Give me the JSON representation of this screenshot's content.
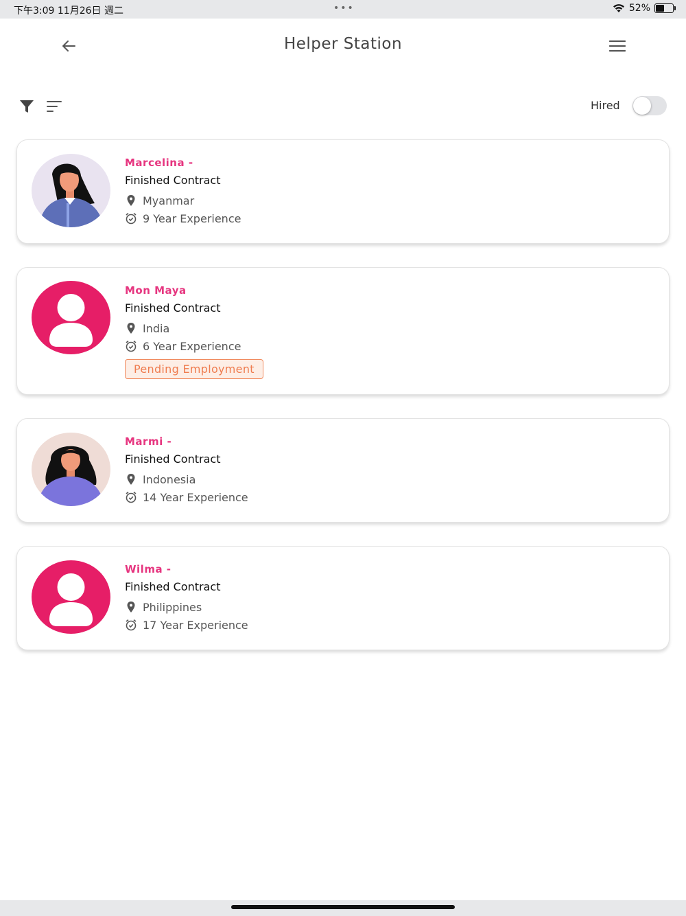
{
  "status_bar": {
    "time_date": "下午3:09   11月26日 週二",
    "dots": "•••",
    "battery_text": "52%",
    "battery_level": 0.52
  },
  "header": {
    "title": "Helper Station",
    "back_icon": "arrow-left-icon",
    "menu_icon": "hamburger-menu-icon"
  },
  "toolbar": {
    "filter_icon": "filter-icon",
    "sort_icon": "sort-icon",
    "hired_label": "Hired",
    "hired_on": false
  },
  "colors": {
    "accent": "#e6357f",
    "avatar_placeholder": "#e61e67",
    "badge_text": "#ef7c4f",
    "badge_bg": "#fdeee6"
  },
  "helpers": [
    {
      "name": "Marcelina -",
      "status": "Finished Contract",
      "country": "Myanmar",
      "experience": "9 Year Experience",
      "badge": "",
      "avatar": "illustration-woman-blue"
    },
    {
      "name": "Mon Maya",
      "status": "Finished Contract",
      "country": "India",
      "experience": "6 Year Experience",
      "badge": "Pending Employment",
      "avatar": "placeholder-user-icon"
    },
    {
      "name": "Marmi -",
      "status": "Finished Contract",
      "country": "Indonesia",
      "experience": "14 Year Experience",
      "badge": "",
      "avatar": "illustration-woman-purple"
    },
    {
      "name": "Wilma -",
      "status": "Finished Contract",
      "country": "Philippines",
      "experience": "17 Year Experience",
      "badge": "",
      "avatar": "placeholder-user-icon"
    }
  ]
}
